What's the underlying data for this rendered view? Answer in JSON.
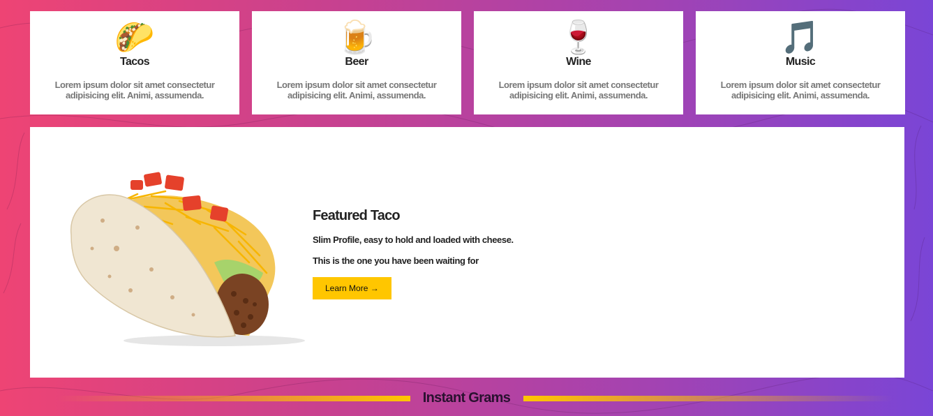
{
  "features": [
    {
      "icon": "taco-icon",
      "glyph": "🌮",
      "title": "Tacos",
      "text": "Lorem ipsum dolor sit amet consectetur adipisicing elit. Animi, assumenda."
    },
    {
      "icon": "beer-icon",
      "glyph": "🍺",
      "title": "Beer",
      "text": "Lorem ipsum dolor sit amet consectetur adipisicing elit. Animi, assumenda."
    },
    {
      "icon": "wine-icon",
      "glyph": "🍷",
      "title": "Wine",
      "text": "Lorem ipsum dolor sit amet consectetur adipisicing elit. Animi, assumenda."
    },
    {
      "icon": "music-icon",
      "glyph": "🎵",
      "title": "Music",
      "text": "Lorem ipsum dolor sit amet consectetur adipisicing elit. Animi, assumenda."
    }
  ],
  "hero": {
    "title": "Featured Taco",
    "line1": "Slim Profile, easy to hold and loaded with cheese.",
    "line2": "This is the one you have been waiting for",
    "button": "Learn More →"
  },
  "section": {
    "title": "Instant Grams"
  },
  "colors": {
    "accent": "#ffc600",
    "gradient_start": "#ee4474",
    "gradient_end": "#7a45d6"
  }
}
